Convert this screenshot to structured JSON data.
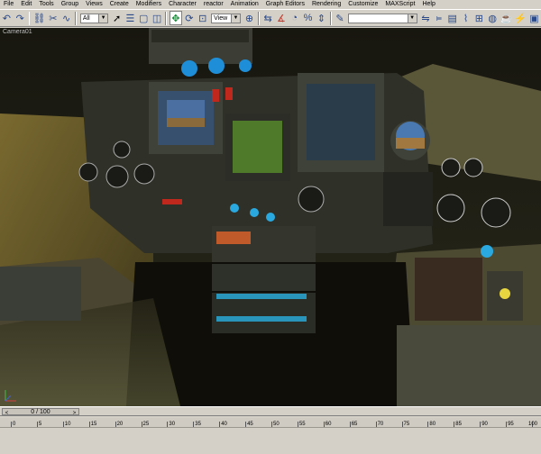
{
  "menubar": {
    "items": [
      "File",
      "Edit",
      "Tools",
      "Group",
      "Views",
      "Create",
      "Modifiers",
      "Character",
      "reactor",
      "Animation",
      "Graph Editors",
      "Rendering",
      "Customize",
      "MAXScript",
      "Help"
    ]
  },
  "toolbar": {
    "selection_filter": "All",
    "coordinate_system": "View",
    "named_selection_value": "",
    "icons": [
      "undo-icon",
      "redo-icon",
      "select-link-icon",
      "unlink-icon",
      "bind-space-warp-icon",
      "selection-filter",
      "select-icon",
      "select-by-name-icon",
      "region-select-icon",
      "window-crossing-icon",
      "move-icon",
      "rotate-icon",
      "scale-icon",
      "reference-coordinate-system",
      "pivot-center-icon",
      "mirror-icon",
      "align-icon",
      "snaps-toggle-icon",
      "angle-snap-icon",
      "percent-snap-icon",
      "spinner-snap-icon",
      "edit-named-selection-icon",
      "named-selection-set",
      "material-editor-icon",
      "render-scene-icon",
      "quick-render-icon",
      "render-type-icon"
    ]
  },
  "viewport": {
    "label": "Camera01",
    "colors": {
      "background": "#232319",
      "panel": "#3b3d34",
      "screen_green": "#4e7a2a",
      "mfd_blue": "#36506e",
      "wall": "#6e5d2e"
    }
  },
  "timeslider": {
    "position": "0 / 100",
    "prev": "<",
    "next": ">"
  },
  "trackbar": {
    "ticks": [
      "0",
      "5",
      "10",
      "15",
      "20",
      "25",
      "30",
      "35",
      "40",
      "45",
      "50",
      "55",
      "60",
      "65",
      "70",
      "75",
      "80",
      "85",
      "90",
      "95",
      "100"
    ]
  }
}
